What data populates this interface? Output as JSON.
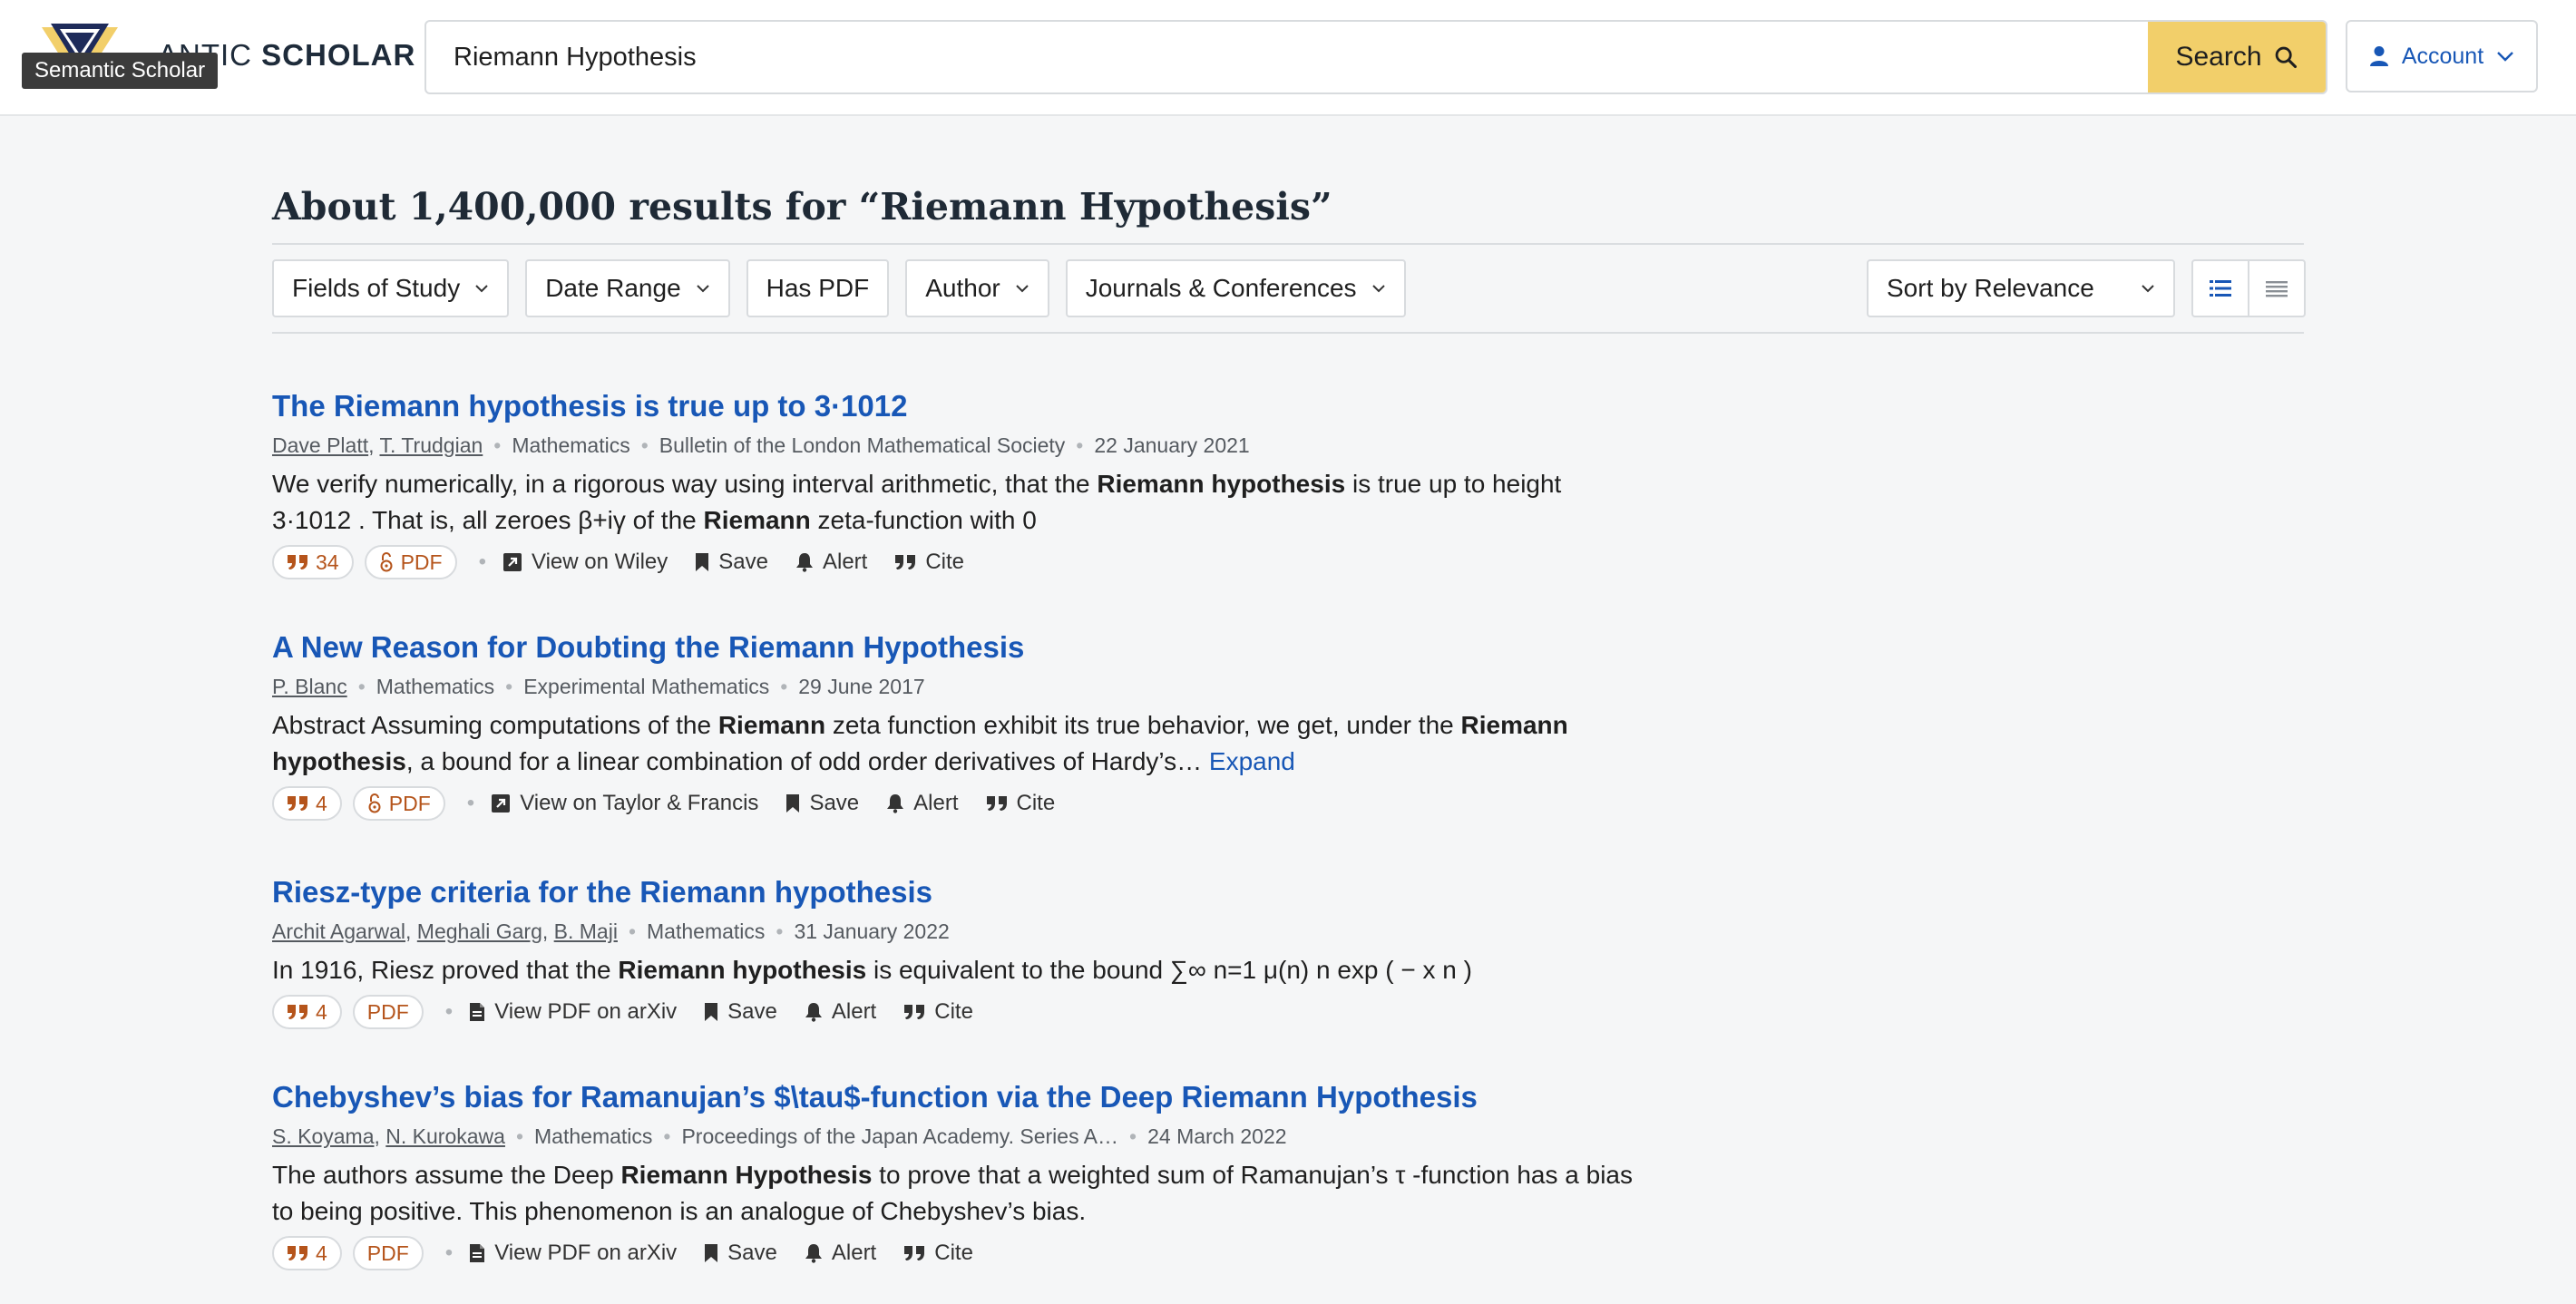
{
  "header": {
    "logo_text_partial": "ANTIC",
    "logo_text_bold": "SCHOLAR",
    "tooltip": "Semantic Scholar",
    "search_value": "Riemann Hypothesis",
    "search_button_label": "Search",
    "account_label": "Account"
  },
  "results_heading": "About 1,400,000 results for “Riemann Hypothesis”",
  "filters": [
    {
      "label": "Fields of Study",
      "has_dropdown": true
    },
    {
      "label": "Date Range",
      "has_dropdown": true
    },
    {
      "label": "Has PDF",
      "has_dropdown": false
    },
    {
      "label": "Author",
      "has_dropdown": true
    },
    {
      "label": "Journals & Conferences",
      "has_dropdown": true
    }
  ],
  "sort": {
    "label": "Sort by Relevance"
  },
  "colors": {
    "link": "#1857b6",
    "accent": "#f2cf6a",
    "citation": "#b5541b"
  },
  "results": [
    {
      "title": "The Riemann hypothesis is true up to 3·1012",
      "authors": [
        "Dave Platt",
        "T. Trudgian"
      ],
      "field": "Mathematics",
      "venue": "Bulletin of the London Mathematical Society",
      "date": "22 January 2021",
      "abstract_html": "We verify numerically, in a rigorous way using interval arithmetic, that the <b>Riemann hypothesis</b> is true up to height 3·1012 . That is, all zeroes β+iγ of the <b>Riemann</b> zeta-function with 0",
      "expand": "",
      "citations": "34",
      "pdf_label": "PDF",
      "pdf_open_access": true,
      "view_label": "View on Wiley",
      "view_icon": "external-link-icon",
      "save": "Save",
      "alert": "Alert",
      "cite": "Cite"
    },
    {
      "title": "A New Reason for Doubting the Riemann Hypothesis",
      "authors": [
        "P. Blanc"
      ],
      "field": "Mathematics",
      "venue": "Experimental Mathematics",
      "date": "29 June 2017",
      "abstract_html": "Abstract Assuming computations of the <b>Riemann</b> zeta function exhibit its true behavior, we get, under the <b>Riemann hypothesis</b>, a bound for a linear combination of odd order derivatives of Hardy’s…",
      "expand": "Expand",
      "citations": "4",
      "pdf_label": "PDF",
      "pdf_open_access": true,
      "view_label": "View on Taylor & Francis",
      "view_icon": "external-link-icon",
      "save": "Save",
      "alert": "Alert",
      "cite": "Cite"
    },
    {
      "title": "Riesz-type criteria for the Riemann hypothesis",
      "authors": [
        "Archit Agarwal",
        "Meghali Garg",
        "B. Maji"
      ],
      "field": "Mathematics",
      "venue": "",
      "date": "31 January 2022",
      "abstract_html": "In 1916, Riesz proved that the <b>Riemann hypothesis</b> is equivalent to the bound ∑∞ n=1 μ(n) n exp ( − x n )",
      "expand": "",
      "citations": "4",
      "pdf_label": "PDF",
      "pdf_open_access": false,
      "view_label": "View PDF on arXiv",
      "view_icon": "pdf-file-icon",
      "save": "Save",
      "alert": "Alert",
      "cite": "Cite"
    },
    {
      "title": "Chebyshev’s bias for Ramanujan’s $\\tau$-function via the Deep Riemann Hypothesis",
      "authors": [
        "S. Koyama",
        "N. Kurokawa"
      ],
      "field": "Mathematics",
      "venue": "Proceedings of the Japan Academy. Series A…",
      "date": "24 March 2022",
      "abstract_html": "The authors assume the Deep <b>Riemann Hypothesis</b> to prove that a weighted sum of Ramanujan’s τ -function has a bias to being positive. This phenomenon is an analogue of Chebyshev’s bias.",
      "expand": "",
      "citations": "4",
      "pdf_label": "PDF",
      "pdf_open_access": false,
      "view_label": "View PDF on arXiv",
      "view_icon": "pdf-file-icon",
      "save": "Save",
      "alert": "Alert",
      "cite": "Cite"
    }
  ]
}
